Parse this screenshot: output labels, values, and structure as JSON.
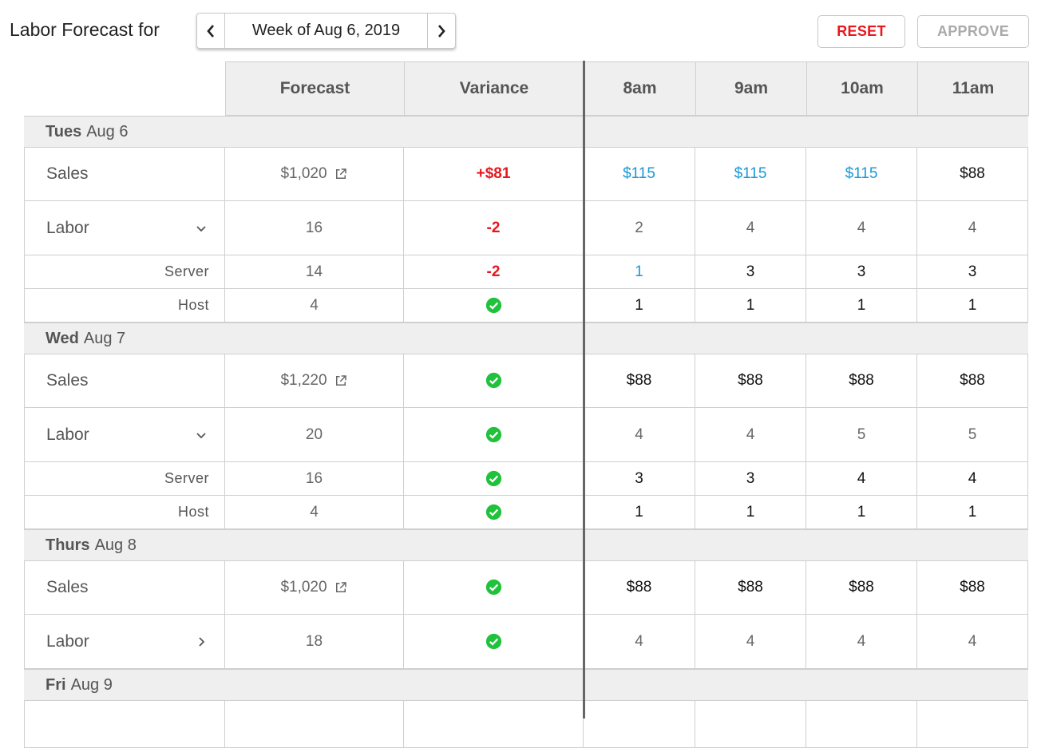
{
  "header": {
    "title": "Labor Forecast for",
    "week_label": "Week of Aug 6, 2019",
    "reset_label": "RESET",
    "approve_label": "APPROVE"
  },
  "columns": {
    "forecast": "Forecast",
    "variance": "Variance",
    "hours": [
      "8am",
      "9am",
      "10am",
      "11am"
    ]
  },
  "days": [
    {
      "day": "Tues",
      "date": "Aug 6",
      "sales": {
        "label": "Sales",
        "forecast": "$1,020",
        "variance": "+$81",
        "hours": [
          "$115",
          "$115",
          "$115",
          "$88"
        ]
      },
      "labor": {
        "label": "Labor",
        "forecast": "16",
        "variance": "-2",
        "hours": [
          "2",
          "4",
          "4",
          "4"
        ]
      },
      "server": {
        "label": "Server",
        "forecast": "14",
        "variance": "-2",
        "hours": [
          "1",
          "3",
          "3",
          "3"
        ]
      },
      "host": {
        "label": "Host",
        "forecast": "4",
        "variance": "",
        "hours": [
          "1",
          "1",
          "1",
          "1"
        ]
      }
    },
    {
      "day": "Wed",
      "date": "Aug 7",
      "sales": {
        "label": "Sales",
        "forecast": "$1,220",
        "variance": "",
        "hours": [
          "$88",
          "$88",
          "$88",
          "$88"
        ]
      },
      "labor": {
        "label": "Labor",
        "forecast": "20",
        "variance": "",
        "hours": [
          "4",
          "4",
          "5",
          "5"
        ]
      },
      "server": {
        "label": "Server",
        "forecast": "16",
        "variance": "",
        "hours": [
          "3",
          "3",
          "4",
          "4"
        ]
      },
      "host": {
        "label": "Host",
        "forecast": "4",
        "variance": "",
        "hours": [
          "1",
          "1",
          "1",
          "1"
        ]
      }
    },
    {
      "day": "Thurs",
      "date": "Aug 8",
      "sales": {
        "label": "Sales",
        "forecast": "$1,020",
        "variance": "",
        "hours": [
          "$88",
          "$88",
          "$88",
          "$88"
        ]
      },
      "labor": {
        "label": "Labor",
        "forecast": "18",
        "variance": "",
        "hours": [
          "4",
          "4",
          "4",
          "4"
        ]
      }
    },
    {
      "day": "Fri",
      "date": "Aug 9"
    }
  ],
  "colors": {
    "accent_red": "#e8161d",
    "blue": "#1a98d5",
    "check_green": "#1fc23a"
  },
  "icons": {
    "prev": "chevron-left-icon",
    "next": "chevron-right-icon",
    "expand": "chevron-down-icon",
    "collapsed": "chevron-right-icon",
    "external": "external-link-icon",
    "ok": "check-circle-icon"
  }
}
